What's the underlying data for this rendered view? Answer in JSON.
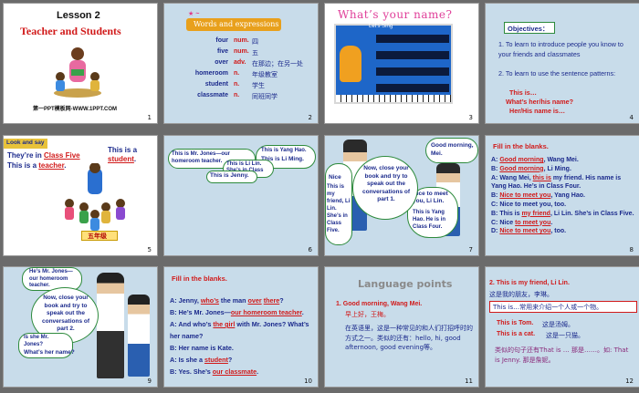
{
  "slides": [
    {
      "num": "1",
      "lesson": "Lesson 2",
      "title": "Teacher and Students",
      "footer": "第一PPT模板网-WWW.1PPT.COM"
    },
    {
      "num": "2",
      "banner": "Words and expressions",
      "vocab": [
        {
          "word": "four",
          "pos": "num.",
          "meaning": "四"
        },
        {
          "word": "five",
          "pos": "num.",
          "meaning": "五"
        },
        {
          "word": "over",
          "pos": "adv.",
          "meaning": "在那边；在另一处"
        },
        {
          "word": "homeroom",
          "pos": "n.",
          "meaning": "年级教室"
        },
        {
          "word": "student",
          "pos": "n.",
          "meaning": "学生"
        },
        {
          "word": "classmate",
          "pos": "n.",
          "meaning": "同班同学"
        }
      ]
    },
    {
      "num": "3",
      "title": "What’s your name?",
      "sign": "Let's Sing"
    },
    {
      "num": "4",
      "heading": "Objectives：",
      "items": [
        "1. To learn to introduce people you know to your friends and classmates",
        "2. To learn to use the sentence patterns:"
      ],
      "patterns": [
        "This is…",
        "What’s her/his name?",
        "Her/His name is…"
      ]
    },
    {
      "num": "5",
      "tag": "Look and say",
      "l1a": "They’re in",
      "l1b": "Class Five",
      "l2a": "This is a",
      "l2b": "teacher",
      "r1": "This is a",
      "r2": "student",
      "dot": ".",
      "sign": "五年级"
    },
    {
      "num": "6",
      "b1": "This is Mr. Jones—our homeroom teacher.",
      "b2": "This is Yang Hao.",
      "b3": "This is Li Ming.",
      "b4": "This is Li Lin. She’s in Class Five.",
      "b5": "This is Jenny."
    },
    {
      "num": "7",
      "speech1": "Good morning, Mei.",
      "cloud": "Now, close your book and try to speak out the conversations of part 1.",
      "b_left": "Nice",
      "b_left2": "This is my friend, Li Lin. She’s in Class Five.",
      "b_right": "Nice to meet you, Li Lin.",
      "b_right2": "This is Yang Hao. He is in Class Four."
    },
    {
      "num": "8",
      "heading": "Fill in the blanks.",
      "lines": [
        {
          "pre": "A: ",
          "ans": "Good morning",
          "post": ", Wang Mei."
        },
        {
          "pre": "B: ",
          "ans": "Good morning",
          "post": ", Li Ming."
        },
        {
          "pre": "A: Wang Mei, ",
          "ans": "this is",
          "post": " my friend. His name is Yang Hao. He’s in Class Four."
        },
        {
          "pre": "B: ",
          "ans": "Nice to meet you",
          "post": ", Yang Hao."
        },
        {
          "pre": "C: Nice to meet you, too.",
          "ans": "",
          "post": ""
        },
        {
          "pre": "B: This is ",
          "ans": "my friend",
          "post": ", Li Lin. She’s in Class Five."
        },
        {
          "pre": "C: Nice ",
          "ans": "to meet you",
          "post": "."
        },
        {
          "pre": "D: ",
          "ans": "Nice to meet you",
          "post": ", too."
        }
      ]
    },
    {
      "num": "9",
      "b1": "He’s Mr. Jones—our homeroom teacher.",
      "cloud": "Now, close your book and try to speak out the conversations of part 2.",
      "b2": "Is she Mr. Jones?",
      "b3": "What’s her name?"
    },
    {
      "num": "10",
      "heading": "Fill in the blanks.",
      "lines": [
        {
          "pre": "A: Jenny, ",
          "ans": "who’s",
          "mid": " the man ",
          "ans2": "over",
          "mid2": " ",
          "ans3": "there",
          "post": "?"
        },
        {
          "pre": "B: He’s Mr. Jones—",
          "ans": "our homeroom teacher",
          "post": "."
        },
        {
          "pre": "A: And who’s ",
          "ans": "the girl",
          "post": " with Mr. Jones? What’s her name?"
        },
        {
          "pre": "B: Her name is Kate.",
          "ans": "",
          "post": ""
        },
        {
          "pre": "A: Is she a ",
          "ans": "student",
          "post": "?"
        },
        {
          "pre": "B: Yes. She’s ",
          "ans": "our classmate",
          "post": "."
        }
      ]
    },
    {
      "num": "11",
      "title": "Language points",
      "p1": "1. Good morning, Wang Mei.",
      "p1cn": "早上好，王梅。",
      "p2": "在英语里，这是一种常见的和人们打招呼时的方式之一。类似的还有：hello, hi, good afternoon, good evening等。"
    },
    {
      "num": "12",
      "p1": "2. This is my friend, Li Lin.",
      "p1cn": "这是我的朋友，李琳。",
      "box": "This is…常用来介绍一个人或一个物。",
      "ex1": "This is Tom.",
      "ex1cn": "这是汤姆。",
      "ex2": "This is a cat.",
      "ex2cn": "这是一只猫。",
      "note": "类似的句子还有That is … 那是……。如: That is Jenny. 那是詹妮。"
    }
  ],
  "colors": {
    "red": "#d11a1a",
    "navy": "#1b2a8c",
    "green": "#2d8a3c",
    "panel": "#c8dcea"
  }
}
